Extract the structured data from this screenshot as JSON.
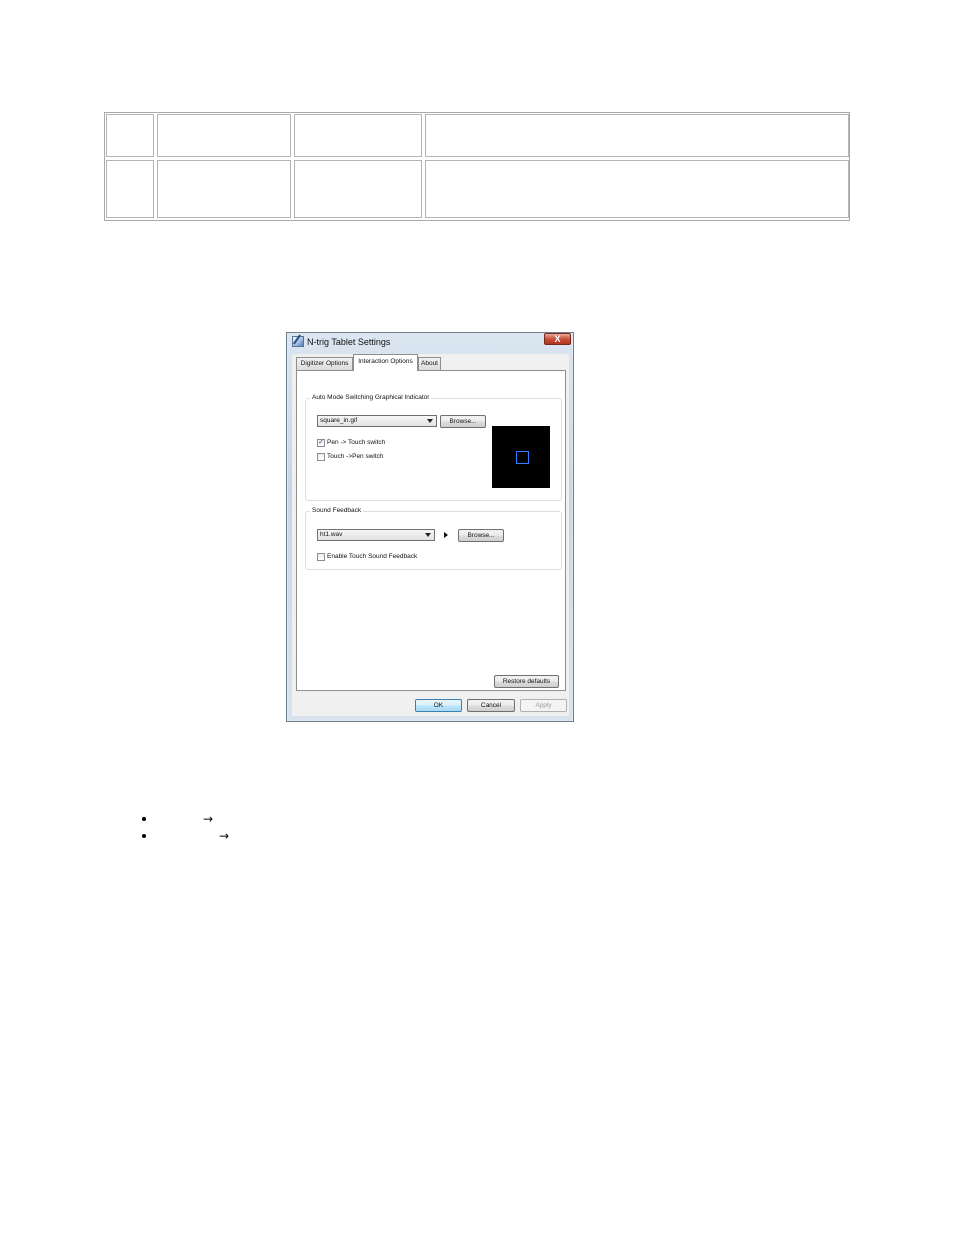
{
  "dialog": {
    "title": "N-trig Tablet Settings",
    "close_label": "X",
    "tabs": [
      {
        "label": "Digitizer Options",
        "active": false
      },
      {
        "label": "Interaction Options",
        "active": true
      },
      {
        "label": "About",
        "active": false
      }
    ],
    "graphical_indicator": {
      "group_label": "Auto Mode Switching Graphical Indicator",
      "selected_file": "square_in.gif",
      "browse_label": "Browse...",
      "pen_to_touch": {
        "label": "Pen -> Touch switch",
        "checked": true,
        "mark": "✓"
      },
      "touch_to_pen": {
        "label": "Touch ->Pen switch",
        "checked": false
      }
    },
    "sound_feedback": {
      "group_label": "Sound Feedback",
      "selected_file": "ht1.wav",
      "browse_label": "Browse...",
      "enable_touch_sound": {
        "label": "Enable Touch Sound Feedback",
        "checked": false
      }
    },
    "restore_defaults_label": "Restore defaults",
    "ok_label": "OK",
    "cancel_label": "Cancel",
    "apply_label": "Apply"
  },
  "bullets": [
    {
      "arrow": "→"
    },
    {
      "arrow": "→"
    }
  ],
  "colors": {
    "preview_background": "#000000",
    "preview_square": "#2f7cff",
    "close_button": "#c9503a"
  }
}
